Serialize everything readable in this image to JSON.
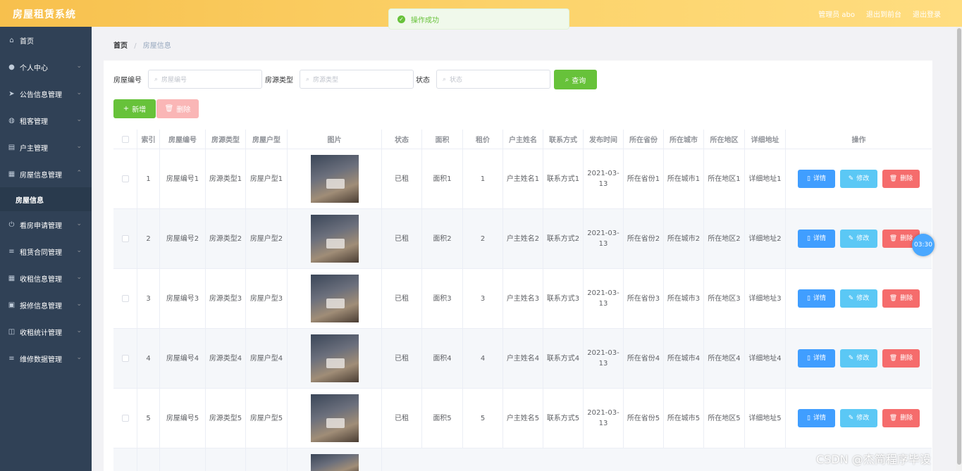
{
  "app": {
    "title": "房屋租赁系统"
  },
  "topbar": {
    "admin": "管理员 abo",
    "back_home": "退出到前台",
    "logout": "退出登录"
  },
  "toast": {
    "message": "操作成功"
  },
  "sidebar": {
    "items": [
      {
        "label": "首页",
        "icon": "home-icon"
      },
      {
        "label": "个人中心",
        "icon": "user-icon"
      },
      {
        "label": "公告信息管理",
        "icon": "send-icon"
      },
      {
        "label": "租客管理",
        "icon": "globe-icon"
      },
      {
        "label": "户主管理",
        "icon": "card-icon"
      },
      {
        "label": "房屋信息管理",
        "icon": "grid-icon"
      },
      {
        "label": "看房申请管理",
        "icon": "power-icon"
      },
      {
        "label": "租赁合同管理",
        "icon": "list-icon"
      },
      {
        "label": "收租信息管理",
        "icon": "grid-icon"
      },
      {
        "label": "报修信息管理",
        "icon": "calendar-icon"
      },
      {
        "label": "收租统计管理",
        "icon": "chart-icon"
      },
      {
        "label": "维修数据管理",
        "icon": "list-icon"
      }
    ],
    "sub_item": "房屋信息"
  },
  "breadcrumb": {
    "home": "首页",
    "current": "房屋信息"
  },
  "filters": {
    "house_no": {
      "label": "房屋编号",
      "placeholder": "房屋编号"
    },
    "house_type": {
      "label": "房源类型",
      "placeholder": "房源类型"
    },
    "status": {
      "label": "状态",
      "placeholder": "状态"
    },
    "query_label": "查询"
  },
  "actions": {
    "add_label": "新增",
    "delete_label": "删除"
  },
  "table": {
    "headers": [
      "索引",
      "房屋编号",
      "房源类型",
      "房屋户型",
      "图片",
      "状态",
      "面积",
      "租价",
      "户主姓名",
      "联系方式",
      "发布时间",
      "所在省份",
      "所在城市",
      "所在地区",
      "详细地址",
      "操作"
    ],
    "rows": [
      {
        "idx": "1",
        "no": "房屋编号1",
        "type": "房源类型1",
        "layout": "房屋户型1",
        "status": "已租",
        "area": "面积1",
        "price": "1",
        "owner": "户主姓名1",
        "contact": "联系方式1",
        "date": "2021-03-13",
        "province": "所在省份1",
        "city": "所在城市1",
        "district": "所在地区1",
        "address": "详细地址1"
      },
      {
        "idx": "2",
        "no": "房屋编号2",
        "type": "房源类型2",
        "layout": "房屋户型2",
        "status": "已租",
        "area": "面积2",
        "price": "2",
        "owner": "户主姓名2",
        "contact": "联系方式2",
        "date": "2021-03-13",
        "province": "所在省份2",
        "city": "所在城市2",
        "district": "所在地区2",
        "address": "详细地址2"
      },
      {
        "idx": "3",
        "no": "房屋编号3",
        "type": "房源类型3",
        "layout": "房屋户型3",
        "status": "已租",
        "area": "面积3",
        "price": "3",
        "owner": "户主姓名3",
        "contact": "联系方式3",
        "date": "2021-03-13",
        "province": "所在省份3",
        "city": "所在城市3",
        "district": "所在地区3",
        "address": "详细地址3"
      },
      {
        "idx": "4",
        "no": "房屋编号4",
        "type": "房源类型4",
        "layout": "房屋户型4",
        "status": "已租",
        "area": "面积4",
        "price": "4",
        "owner": "户主姓名4",
        "contact": "联系方式4",
        "date": "2021-03-13",
        "province": "所在省份4",
        "city": "所在城市4",
        "district": "所在地区4",
        "address": "详细地址4"
      },
      {
        "idx": "5",
        "no": "房屋编号5",
        "type": "房源类型5",
        "layout": "房屋户型5",
        "status": "已租",
        "area": "面积5",
        "price": "5",
        "owner": "户主姓名5",
        "contact": "联系方式5",
        "date": "2021-03-13",
        "province": "所在省份5",
        "city": "所在城市5",
        "district": "所在地区5",
        "address": "详细地址5"
      }
    ],
    "op_detail": "详情",
    "op_edit": "修改",
    "op_delete": "删除"
  },
  "timer": "03:30",
  "watermark": "CSDN @杰简程序毕设",
  "colors": {
    "topbar": "#fcd36b",
    "sidebar": "#304156",
    "success": "#67c23a",
    "primary": "#409eff",
    "danger": "#f56c6c",
    "info": "#5bc8f5"
  }
}
